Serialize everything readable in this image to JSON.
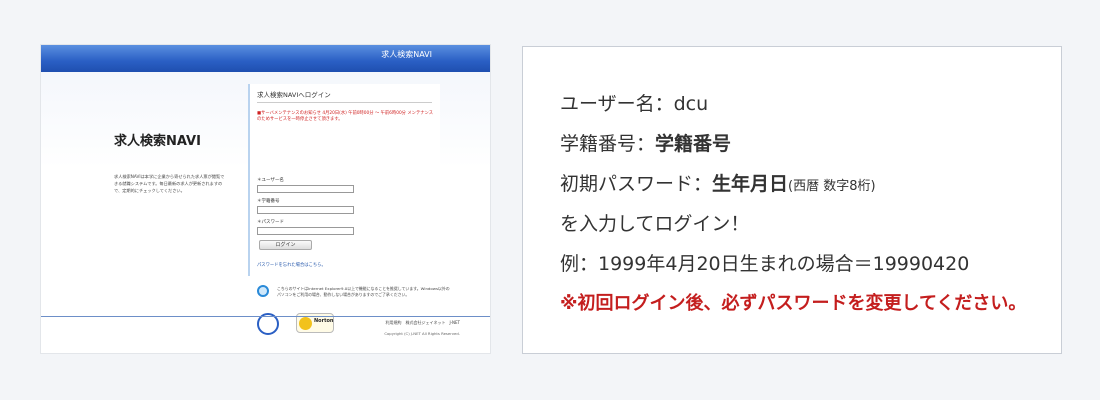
{
  "screenshot": {
    "header_title": "求人検索NAVI",
    "brand": "求人検索NAVI",
    "brand_desc": "求人検索NAVIは本学に企業から寄せられた求人票が閲覧できる就職システムです。毎日最新の求人が更新されますので、定期的にチェックしてください。",
    "panel_title": "求人検索NAVIへログイン",
    "notice": "■サーバメンテナンスのお知らせ 4月20日(水) 午前0時00分 〜 午前6時00分 メンテナンスのためサービスを一時停止させて頂きます。",
    "fields": [
      {
        "label": "＊ユーザー名"
      },
      {
        "label": "＊学籍番号"
      },
      {
        "label": "＊パスワード"
      }
    ],
    "login_button": "ログイン",
    "forgot_link": "パスワードを忘れた場合はこちら。",
    "ie_notice": "こちらのサイトはInternet Explorer9.0以上で機能になることを推奨しています。Windows以外のパソコンをご利用の場合、動作しない場合がありますのでご了承ください。",
    "norton_label": "Norton",
    "footer_links": "利用規約　株式会社ジェイネット　J-NET",
    "copyright": "Copyright (C) J-NET All Rights Reserved."
  },
  "card": {
    "user_label": "ユーザー名：",
    "user_value": "dcu",
    "student_label": "学籍番号：",
    "student_value": "学籍番号",
    "password_label": "初期パスワード：",
    "password_value": "生年月日",
    "password_note": "(西暦 数字8桁)",
    "instruction": "を入力してログイン！",
    "example": "例：1999年4月20日生まれの場合＝19990420",
    "warning": "※初回ログイン後、必ずパスワードを変更してください。"
  }
}
